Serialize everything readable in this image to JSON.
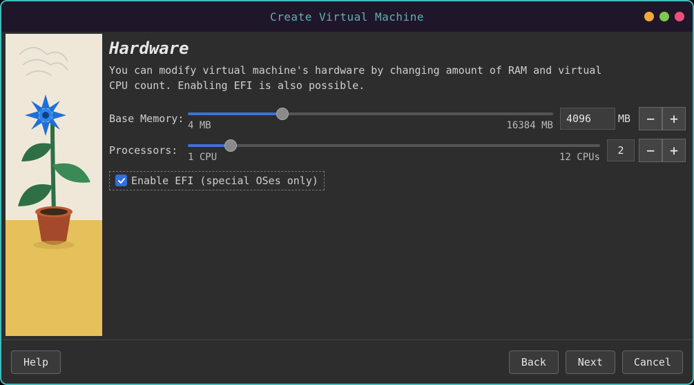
{
  "window": {
    "title": "Create Virtual Machine",
    "traffic_lights": {
      "min": "#f2a93c",
      "max": "#7ec850",
      "close": "#ee4f7a"
    }
  },
  "page": {
    "heading": "Hardware",
    "description": "You can modify virtual machine's hardware by changing amount of RAM and virtual CPU count. Enabling EFI is also possible."
  },
  "memory": {
    "label": "Base Memory:",
    "min_label": "4 MB",
    "max_label": "16384 MB",
    "min": 4,
    "max": 16384,
    "value": 4096,
    "value_display": "4096",
    "unit": "MB"
  },
  "cpu": {
    "label": "Processors:",
    "min_label": "1 CPU",
    "max_label": "12 CPUs",
    "min": 1,
    "max": 12,
    "value": 2,
    "value_display": "2"
  },
  "efi": {
    "checked": true,
    "label": "Enable EFI (special OSes only)"
  },
  "buttons": {
    "help": "Help",
    "back": "Back",
    "next": "Next",
    "cancel": "Cancel",
    "minus": "−",
    "plus": "+"
  }
}
